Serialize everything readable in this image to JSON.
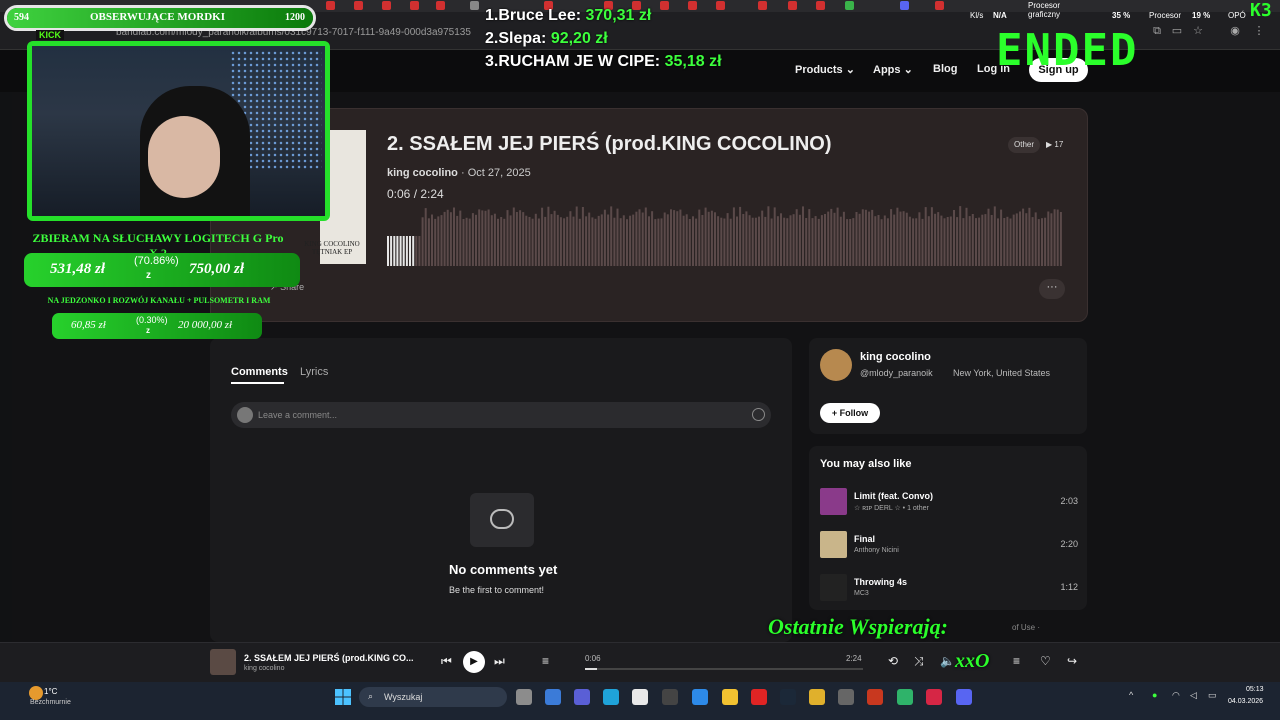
{
  "browser": {
    "url": "bandlab.com/mlody_paranoik/albums/031c9713-7017-f111-9a49-000d3a975135"
  },
  "site_nav": {
    "products": "Products",
    "apps": "Apps",
    "blog": "Blog",
    "login": "Log in",
    "signup": "Sign up"
  },
  "track": {
    "title": "2. SSAŁEM JEJ PIERŚ (prod.KING COCOLINO)",
    "artist": "king cocolino",
    "date": "Oct 27, 2025",
    "separator": "·",
    "elapsed": "0:06",
    "duration": "2:24",
    "genre": "Other",
    "plays": "17",
    "share": "Share",
    "cover_text": "KING COCOLINO TĘTNIAK EP",
    "progress_fraction": 0.042
  },
  "comments": {
    "tab_comments": "Comments",
    "tab_lyrics": "Lyrics",
    "placeholder": "Leave a comment...",
    "empty_title": "No comments yet",
    "empty_sub": "Be the first to comment!"
  },
  "artist_card": {
    "name": "king cocolino",
    "handle": "@mlody_paranoik",
    "location": "New York, United States",
    "follow": "Follow"
  },
  "recommendations": {
    "header": "You may also like",
    "items": [
      {
        "title": "Limit (feat. Convo)",
        "sub": "☆ ʀɪᴘ DERL ☆ • 1 other",
        "duration": "2:03",
        "thumb_color": "#8a3a8a"
      },
      {
        "title": "Final",
        "sub": "Anthony Nicini",
        "duration": "2:20",
        "thumb_color": "#c9b58a"
      },
      {
        "title": "Throwing 4s",
        "sub": "MC3",
        "duration": "1:12",
        "thumb_color": "#222222"
      }
    ],
    "terms": "of Use ·"
  },
  "player": {
    "title": "2. SSAŁEM JEJ PIERŚ (prod.KING CO...",
    "artist": "king cocolino",
    "elapsed": "0:06",
    "total": "2:24"
  },
  "taskbar": {
    "temp": "1°C",
    "weather": "Bezchmurnie",
    "search": "Wyszukaj",
    "time": "05:13",
    "date": "04.03.2026"
  },
  "overlay": {
    "follow_count": "594",
    "follow_label": "OBSERWUJĄCE MORDKI",
    "follow_goal": "1200",
    "kick": "KICK",
    "dono_title": "ZBIERAM NA SŁUCHAWY LOGITECH G Pro X 2",
    "dono_current": "531,48 zł",
    "dono_percent": "(70.86%)",
    "dono_z": "z",
    "dono_goal": "750,00 zł",
    "dono2_title": "NA JEDZONKO I ROZWÓJ KANAŁU + PULSOMETR I RAM",
    "dono2_current": "60,85 zł",
    "dono2_percent": "(0.30%)",
    "dono2_z": "z",
    "dono2_goal": "20 000,00 zł",
    "leaderboard": [
      {
        "rank": "1.",
        "name": "Bruce Lee:",
        "amount": "370,31 zł"
      },
      {
        "rank": "2.",
        "name": "Slepa:",
        "amount": "92,20 zł"
      },
      {
        "rank": "3.",
        "name": "RUCHAM JE W CIPE:",
        "amount": "35,18 zł"
      }
    ],
    "ended": "ENDED",
    "last_supporter_label": "Ostatnie Wspierają:",
    "last_supporter_name": "xxO",
    "channel_tag": "K3"
  },
  "monitor": {
    "kl_label": "Kl/s",
    "kl_value": "N/A",
    "gpu_label": "Procesor graficzny",
    "gpu_value": "35 %",
    "cpu_label": "Procesor",
    "cpu_value": "19 %",
    "extra": "OPÓ"
  },
  "colors": {
    "accent_green": "#2bff2b",
    "card_bg": "#2a2323",
    "page_bg": "#121214"
  }
}
